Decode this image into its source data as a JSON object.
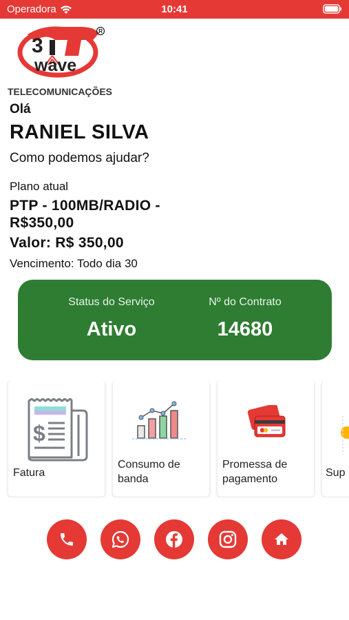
{
  "status_bar": {
    "carrier": "Operadora",
    "time": "10:41"
  },
  "brand": {
    "logo_text": "wave",
    "logo_subtitle": "TELECOMUNICAÇÕES"
  },
  "greeting": {
    "hello": "Olá",
    "name": "RANIEL SILVA",
    "question": "Como podemos ajudar?"
  },
  "plan": {
    "label": "Plano atual",
    "name": "PTP - 100MB/RADIO - R$350,00",
    "value": "Valor: R$ 350,00",
    "due": "Vencimento: Todo dia 30"
  },
  "service": {
    "status_label": "Status do Serviço",
    "status_value": "Ativo",
    "contract_label": "Nº do Contrato",
    "contract_value": "14680",
    "card_color": "#2e7d32"
  },
  "tiles": [
    {
      "label": "Fatura",
      "icon": "invoice-icon"
    },
    {
      "label": "Consumo de banda",
      "icon": "bar-chart-icon"
    },
    {
      "label": "Promessa de pagamento",
      "icon": "credit-card-icon"
    },
    {
      "label": "Sup",
      "icon": "support-icon"
    }
  ],
  "social_buttons": [
    {
      "icon": "phone-icon"
    },
    {
      "icon": "whatsapp-icon"
    },
    {
      "icon": "facebook-icon"
    },
    {
      "icon": "instagram-icon"
    },
    {
      "icon": "home-icon"
    }
  ],
  "colors": {
    "accent": "#e53935",
    "status_green": "#2e7d32"
  }
}
